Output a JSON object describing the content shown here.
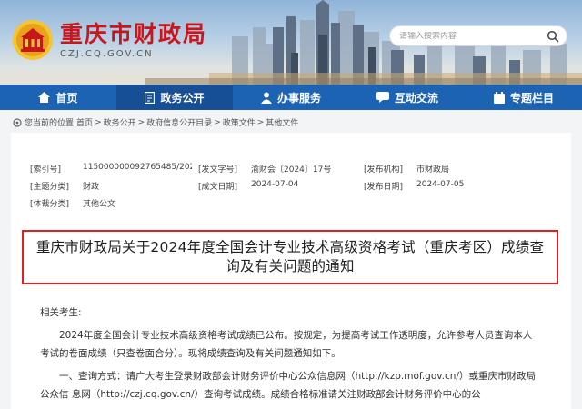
{
  "site": {
    "title": "重庆市财政局",
    "domain": "CZJ.CQ.GOV.CN"
  },
  "search": {
    "placeholder": "请输入搜索内容"
  },
  "nav": {
    "items": [
      {
        "label": "首页",
        "icon": "home-icon"
      },
      {
        "label": "政务公开",
        "icon": "document-icon"
      },
      {
        "label": "办事服务",
        "icon": "person-icon"
      },
      {
        "label": "互动交流",
        "icon": "chat-icon"
      },
      {
        "label": "专题栏目",
        "icon": "bookmark-icon"
      }
    ],
    "active_index": 1
  },
  "breadcrumb": {
    "prefix": "您当前的位置:",
    "items": [
      "首页",
      "政务公开",
      "政府信息公开目录",
      "政策文件",
      "其他文件"
    ],
    "separator": ">"
  },
  "meta": {
    "index_no_label": "[索引号]",
    "index_no_value": "11500000009276548​5/2024...",
    "doc_no_label": "[发文字号]",
    "doc_no_value": "渝财会〔2024〕17号",
    "issuer_label": "[发布机构]",
    "issuer_value": "市财政局",
    "topic_label": "[主题分类]",
    "topic_value": "财政",
    "written_date_label": "[成文日期]",
    "written_date_value": "2024-07-04",
    "publish_date_label": "[发布日期]",
    "publish_date_value": "2024-07-05",
    "form_label": "[体裁分类]",
    "form_value": "其他公文"
  },
  "article": {
    "title": "重庆市财政局关于2024年度全国会计专业技术高级资格考试（重庆考区）成绩查询及有关问题的通知",
    "salutation": "相关考生:",
    "para1": "2024年度全国会计专业技术高级资格考试成绩已公布。按规定，为提高考试工作透明度，允许参考人员查询本人考试的卷面成绩（只查卷面合分）。现将成绩查询及有关问题通知如下。",
    "para2": "一、查询方式：请广大考生登录财政部会计财务评价中心公众信息网（http://kzp.mof.gov.cn/）或重庆市财政局公众信 息网（http://czj.cq.gov.cn/）查询考试成绩。成绩合格标准请关注财政部会计财务评价中心的公"
  },
  "colors": {
    "brand_red": "#c8161d",
    "nav_blue": "#1d63b3",
    "nav_active": "#164f95",
    "highlight_border": "#e02020"
  }
}
